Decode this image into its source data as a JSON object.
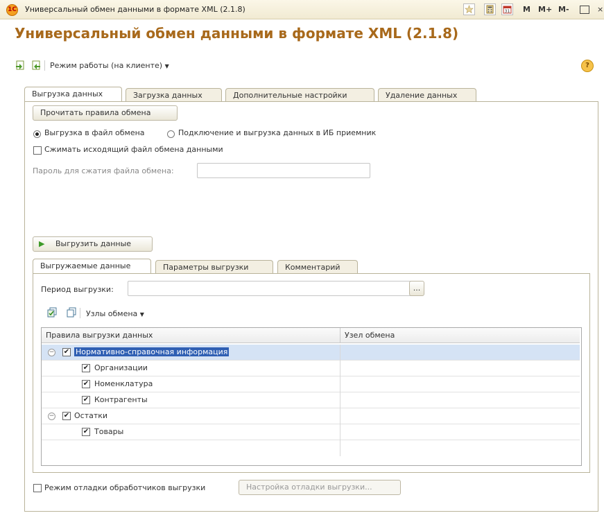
{
  "window": {
    "title": "Универсальный обмен данными в формате XML (2.1.8)",
    "logo": "1C",
    "buttons": [
      "M",
      "M+",
      "M-"
    ]
  },
  "page": {
    "heading": "Универсальный обмен данными в формате XML (2.1.8)",
    "mode_menu": "Режим работы (на клиенте)",
    "help": "?"
  },
  "tabs": [
    "Выгрузка данных",
    "Загрузка данных",
    "Дополнительные настройки",
    "Удаление данных"
  ],
  "export": {
    "read_rules_button": "Прочитать правила обмена",
    "radio_file": "Выгрузка в файл обмена",
    "radio_ib": "Подключение и выгрузка данных в ИБ приемник",
    "compress_label": "Сжимать исходящий файл обмена данными",
    "password_label": "Пароль для сжатия файла обмена:",
    "password_value": "",
    "export_button": "Выгрузить данные"
  },
  "subtabs": [
    "Выгружаемые данные",
    "Параметры выгрузки",
    "Комментарий"
  ],
  "period": {
    "label": "Период выгрузки:",
    "value": "",
    "choose": "..."
  },
  "nodes_menu": "Узлы обмена",
  "grid": {
    "columns": [
      "Правила выгрузки данных",
      "Узел обмена"
    ],
    "rows": [
      {
        "label": "Нормативно-справочная информация",
        "level": 0,
        "checked": true,
        "group": true,
        "selected": true
      },
      {
        "label": "Организации",
        "level": 1,
        "checked": true,
        "group": false,
        "selected": false
      },
      {
        "label": "Номенклатура",
        "level": 1,
        "checked": true,
        "group": false,
        "selected": false
      },
      {
        "label": "Контрагенты",
        "level": 1,
        "checked": true,
        "group": false,
        "selected": false
      },
      {
        "label": "Остатки",
        "level": 0,
        "checked": true,
        "group": true,
        "selected": false
      },
      {
        "label": "Товары",
        "level": 1,
        "checked": true,
        "group": false,
        "selected": false
      }
    ]
  },
  "debug": {
    "label": "Режим отладки обработчиков выгрузки",
    "settings_button": "Настройка отладки выгрузки..."
  },
  "colors": {
    "heading": "#a8691b",
    "selected_row": "#d5e3f5",
    "selected_text_bg": "#2f5fb3"
  }
}
